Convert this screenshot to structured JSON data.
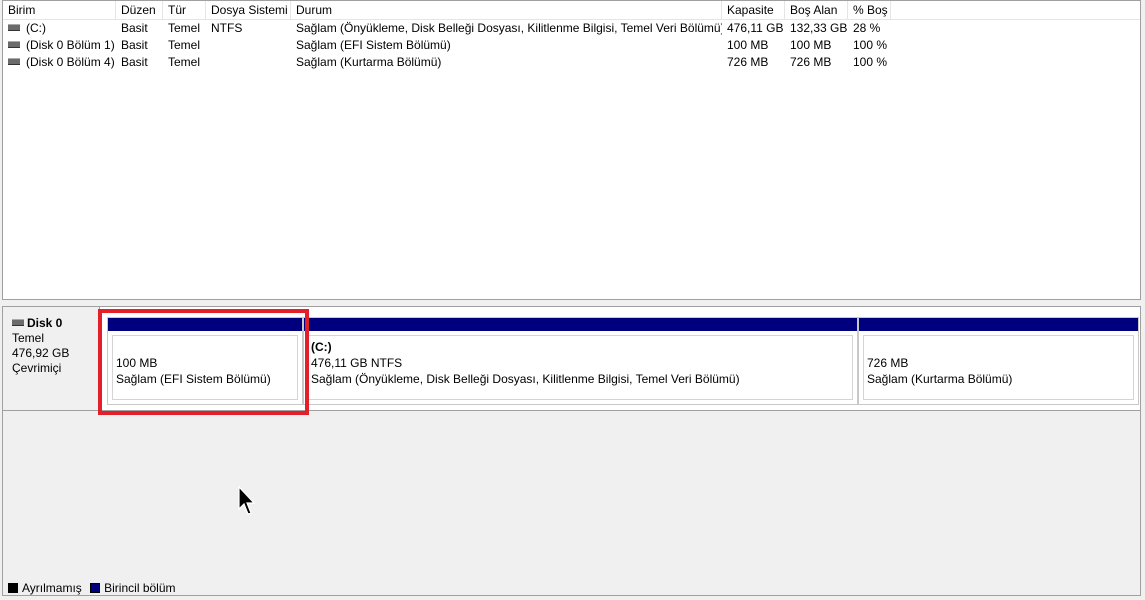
{
  "volume_list": {
    "columns": [
      "Birim",
      "Düzen",
      "Tür",
      "Dosya Sistemi",
      "Durum",
      "Kapasite",
      "Boş Alan",
      "% Boş"
    ],
    "rows": [
      {
        "volume": "(C:)",
        "layout": "Basit",
        "type": "Temel",
        "fs": "NTFS",
        "status": "Sağlam (Önyükleme, Disk Belleği Dosyası, Kilitlenme Bilgisi, Temel Veri Bölümü)",
        "capacity": "476,11 GB",
        "free": "132,33 GB",
        "pct_free": "28 %",
        "icon": "volume-icon"
      },
      {
        "volume": "(Disk 0 Bölüm 1)",
        "layout": "Basit",
        "type": "Temel",
        "fs": "",
        "status": "Sağlam (EFI Sistem Bölümü)",
        "capacity": "100 MB",
        "free": "100 MB",
        "pct_free": "100 %",
        "icon": "volume-icon"
      },
      {
        "volume": "(Disk 0 Bölüm 4)",
        "layout": "Basit",
        "type": "Temel",
        "fs": "",
        "status": "Sağlam (Kurtarma Bölümü)",
        "capacity": "726 MB",
        "free": "726 MB",
        "pct_free": "100 %",
        "icon": "volume-icon"
      }
    ]
  },
  "disk_map": {
    "disk": {
      "name": "Disk 0",
      "type": "Temel",
      "size": "476,92 GB",
      "state": "Çevrimiçi",
      "icon": "disk-icon"
    },
    "partitions": [
      {
        "title": "",
        "size": "100 MB",
        "status": "Sağlam (EFI Sistem Bölümü)",
        "selected": true
      },
      {
        "title": "(C:)",
        "size": "476,11 GB NTFS",
        "status": "Sağlam (Önyükleme, Disk Belleği Dosyası, Kilitlenme Bilgisi, Temel Veri Bölümü)",
        "selected": false
      },
      {
        "title": "",
        "size": "726 MB",
        "status": "Sağlam (Kurtarma Bölümü)",
        "selected": false
      }
    ],
    "partition_bar_color": "#00007f"
  },
  "legend": {
    "items": [
      {
        "label": "Ayrılmamış",
        "color": "#000000"
      },
      {
        "label": "Birincil bölüm",
        "color": "#00007f"
      }
    ]
  },
  "highlight_color": "#e3202a"
}
